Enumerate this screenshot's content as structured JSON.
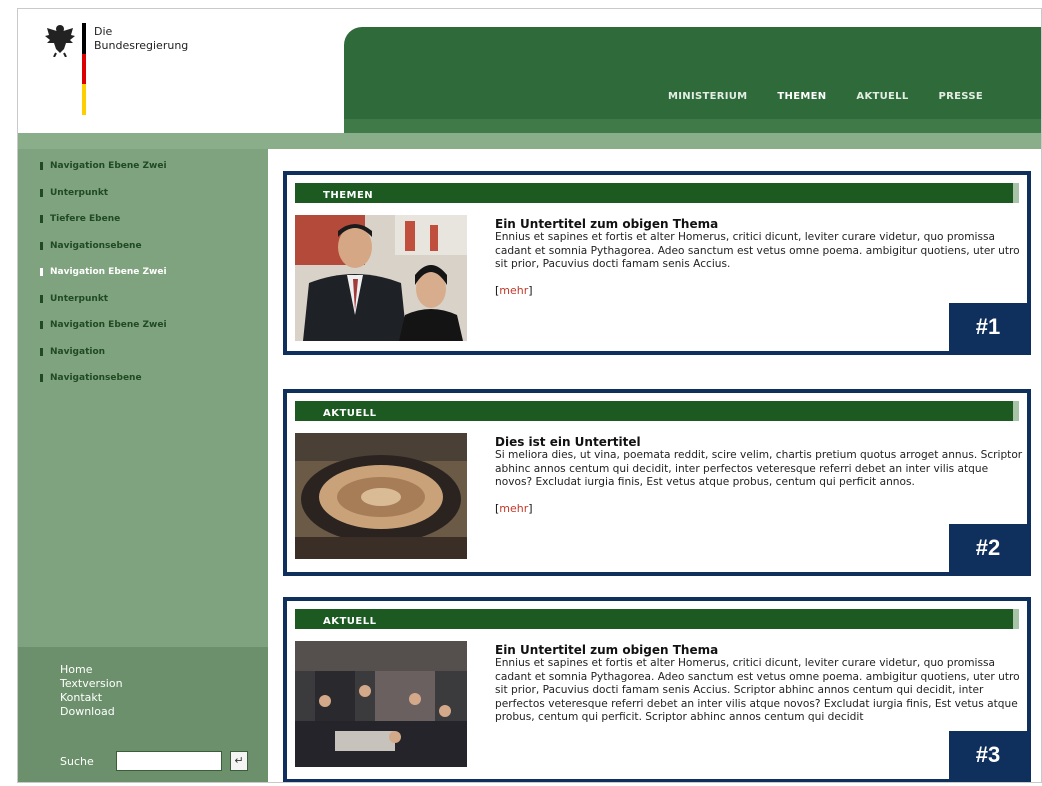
{
  "logo": {
    "line1": "Die",
    "line2": "Bundesregierung"
  },
  "colors": {
    "flag_black": "#000000",
    "flag_red": "#dd0000",
    "flag_gold": "#ffce00",
    "header_green": "#2f6a3a",
    "sidebar_green": "#7fa37f",
    "badge_blue": "#0f2f5d",
    "link_red": "#c0392b"
  },
  "topnav": [
    "MINISTERIUM",
    "THEMEN",
    "AKTUELL",
    "PRESSE"
  ],
  "subnav": [
    "Navigation Ebene Zwei",
    "Unterpunkt",
    "Tiefere Ebene",
    "Navigationsebene",
    "Navigation Ebene Zwei",
    "Unterpunkt",
    "Navigation Ebene Zwei",
    "Navigation",
    "Navigationsebene"
  ],
  "footlinks": [
    "Home",
    "Textversion",
    "Kontakt",
    "Download"
  ],
  "search": {
    "label": "Suche",
    "button": "↵"
  },
  "panels": [
    {
      "header": "THEMEN",
      "title": "Ein Untertitel zum obigen Thema",
      "body": "Ennius et sapines et fortis et alter Homerus, critici dicunt, leviter curare  videtur, quo promissa cadant et somnia Pythagorea. Adeo sanctum est vetus omne poema. ambigitur quotiens, uter utro sit prior, Pacuvius docti famam senis Accius.",
      "more_open": "[",
      "more": "mehr",
      "more_close": "]",
      "badge": "#1"
    },
    {
      "header": "AKTUELL",
      "title": "Dies ist ein Untertitel",
      "body": "Si meliora dies, ut vina, poemata reddit, scire velim, chartis pretium quotus arroget annus. Scriptor abhinc annos centum qui decidit, inter perfectos veteresque referri debet an inter vilis atque novos? Excludat iurgia finis, Est vetus atque probus, centum qui perficit annos.",
      "more_open": "[",
      "more": "mehr",
      "more_close": "]",
      "badge": "#2"
    },
    {
      "header": "AKTUELL",
      "title": "Ein Untertitel zum obigen Thema",
      "body": "Ennius et sapines et fortis et alter Homerus, critici dicunt, leviter curare  videtur, quo promissa cadant et somnia Pythagorea. Adeo sanctum est vetus omne poema. ambigitur quotiens, uter utro sit prior, Pacuvius docti famam senis Accius. Scriptor abhinc annos centum qui decidit, inter perfectos veteresque referri debet an inter vilis atque novos? Excludat iurgia finis, Est vetus atque probus, centum qui perficit. Scriptor abhinc annos centum qui decidit",
      "badge": "#3"
    }
  ]
}
